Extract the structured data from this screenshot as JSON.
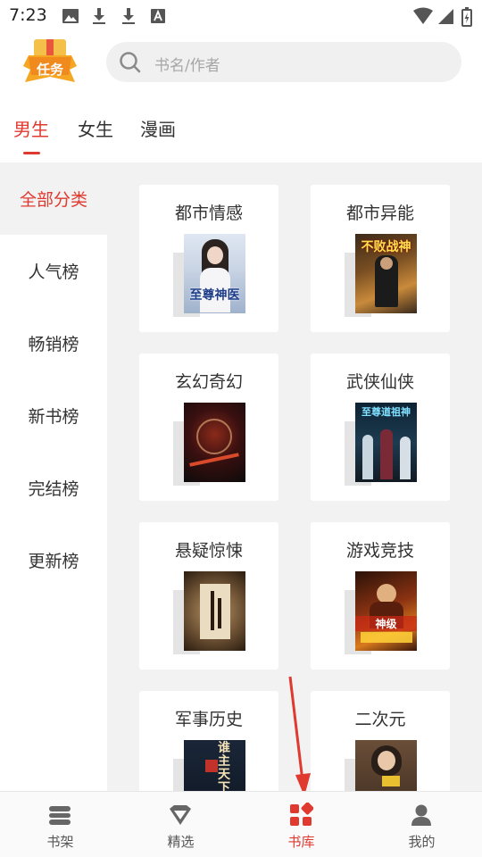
{
  "status_bar": {
    "time": "7:23"
  },
  "colors": {
    "accent": "#e0392f",
    "badge": "#f5a623"
  },
  "header": {
    "task_badge": "任务",
    "search_placeholder": "书名/作者"
  },
  "tabs": [
    {
      "label": "男生"
    },
    {
      "label": "女生"
    },
    {
      "label": "漫画"
    }
  ],
  "sidebar": {
    "items": [
      {
        "label": "全部分类"
      },
      {
        "label": "人气榜"
      },
      {
        "label": "畅销榜"
      },
      {
        "label": "新书榜"
      },
      {
        "label": "完结榜"
      },
      {
        "label": "更新榜"
      }
    ]
  },
  "categories": [
    {
      "name": "都市情感",
      "cover_text": "至尊神医"
    },
    {
      "name": "都市异能",
      "cover_text": "不败战神"
    },
    {
      "name": "玄幻奇幻",
      "cover_text": ""
    },
    {
      "name": "武侠仙侠",
      "cover_text": "至尊道祖神"
    },
    {
      "name": "悬疑惊悚",
      "cover_text": ""
    },
    {
      "name": "游戏竞技",
      "cover_text": "神级"
    },
    {
      "name": "军事历史",
      "cover_text": "谁主天下"
    },
    {
      "name": "二次元",
      "cover_text": ""
    }
  ],
  "bottom_nav": [
    {
      "label": "书架",
      "icon": "bookshelf-icon"
    },
    {
      "label": "精选",
      "icon": "diamond-icon"
    },
    {
      "label": "书库",
      "icon": "library-grid-icon"
    },
    {
      "label": "我的",
      "icon": "person-icon"
    }
  ]
}
